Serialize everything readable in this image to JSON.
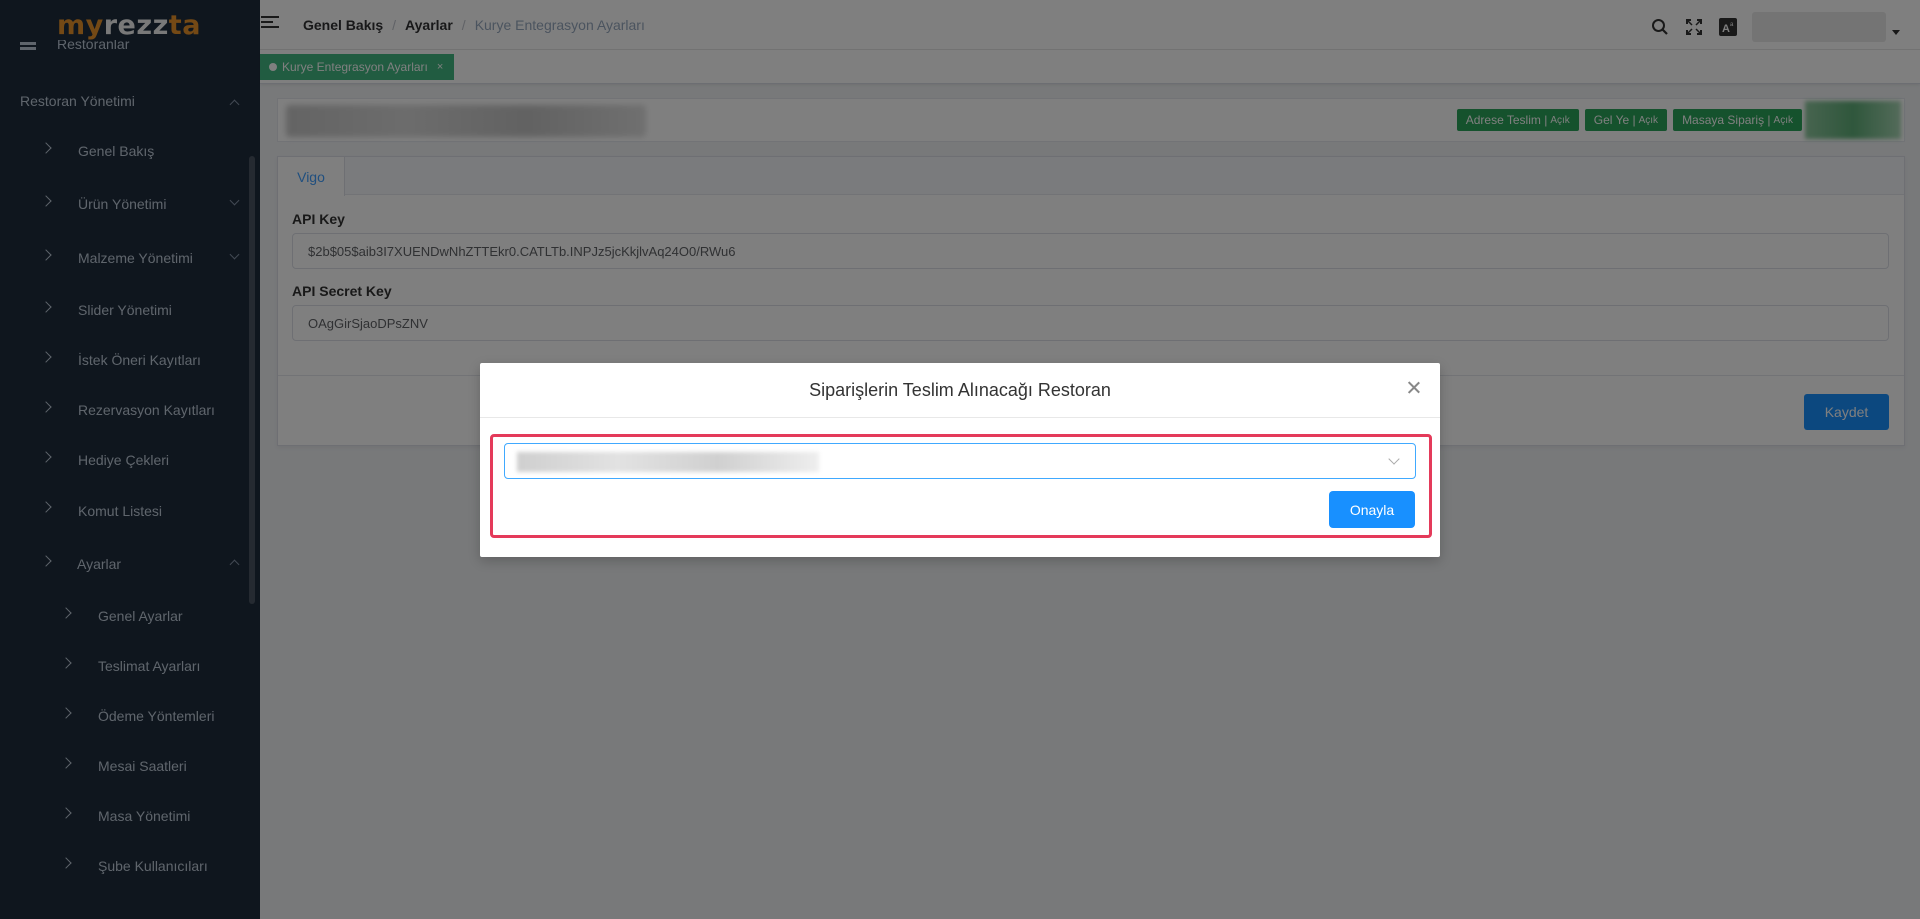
{
  "app": {
    "logo_part1": "my",
    "logo_part2": "rezz",
    "logo_part3": "ta"
  },
  "sidebar": {
    "cut_item": "Restoranlar",
    "section_title": "Restoran Yönetimi",
    "items": [
      {
        "label": "Genel Bakış"
      },
      {
        "label": "Ürün Yönetimi"
      },
      {
        "label": "Malzeme Yönetimi"
      },
      {
        "label": "Slider Yönetimi"
      },
      {
        "label": "İstek Öneri Kayıtları"
      },
      {
        "label": "Rezervasyon Kayıtları"
      },
      {
        "label": "Hediye Çekleri"
      },
      {
        "label": "Komut Listesi"
      },
      {
        "label": "Ayarlar"
      }
    ],
    "sub_items": [
      {
        "label": "Genel Ayarlar"
      },
      {
        "label": "Teslimat Ayarları"
      },
      {
        "label": "Ödeme Yöntemleri"
      },
      {
        "label": "Mesai Saatleri"
      },
      {
        "label": "Masa Yönetimi"
      },
      {
        "label": "Şube Kullanıcıları"
      }
    ]
  },
  "breadcrumb": {
    "item1": "Genel Bakış",
    "item2": "Ayarlar",
    "item3": "Kurye Entegrasyon Ayarları",
    "sep": "/"
  },
  "tags": {
    "active": "Kurye Entegrasyon Ayarları",
    "close": "×"
  },
  "status": {
    "delivery": "Adrese Teslim | ",
    "delivery_state": "Açık",
    "pickup": "Gel Ye | ",
    "pickup_state": "Açık",
    "table": "Masaya Sipariş | ",
    "table_state": "Açık"
  },
  "form": {
    "tab": "Vigo",
    "api_key_label": "API Key",
    "api_key_value": "$2b$05$aib3I7XUENDwNhZTTEkr0.CATLTb.INPJz5jcKkjlvAq24O0/RWu6",
    "api_secret_label": "API Secret Key",
    "api_secret_value": "OAgGirSjaoDPsZNV",
    "save": "Kaydet"
  },
  "modal": {
    "title": "Siparişlerin Teslim Alınacağı Restoran",
    "confirm": "Onayla"
  },
  "colors": {
    "sidebar_bg": "#1f2d3d",
    "primary": "#1890ff",
    "success": "#2aa55a",
    "highlight": "#e43a5a"
  },
  "icons": [
    "hamburger-icon",
    "search-icon",
    "fullscreen-icon",
    "font-size-icon",
    "close-icon",
    "chevron-down-icon"
  ]
}
